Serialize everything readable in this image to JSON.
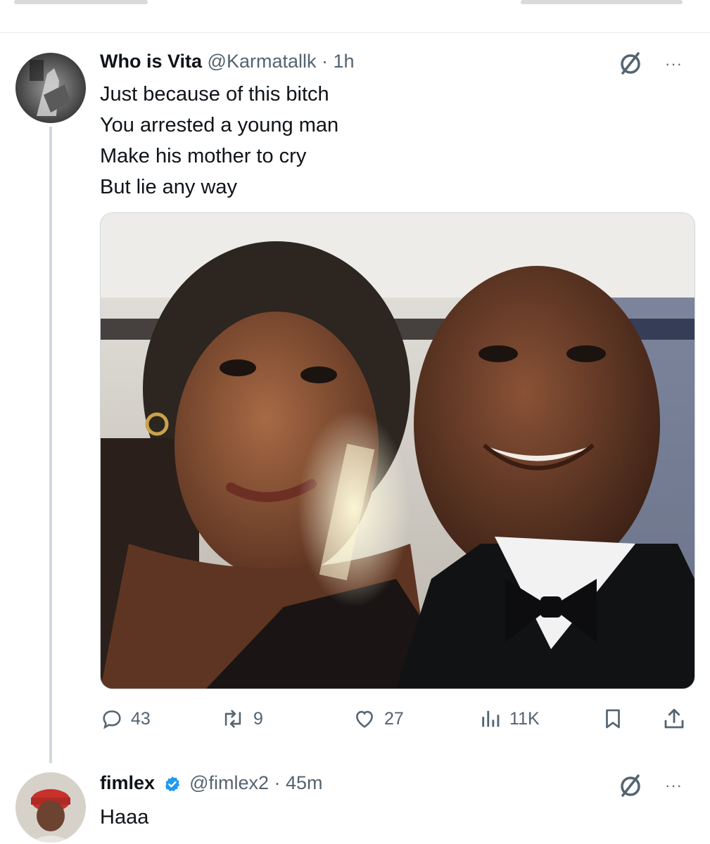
{
  "tweet1": {
    "name": "Who is Vita",
    "handle": "@Karmatallk",
    "separator": " · ",
    "time": "1h",
    "lines": [
      "Just because of this bitch",
      "You arrested a young man",
      "Make his mother to cry",
      "But lie any way"
    ],
    "more_label": "···",
    "stats": {
      "replies": "43",
      "reposts": "9",
      "likes": "27",
      "views": "11K"
    }
  },
  "tweet2": {
    "name": "fimlex",
    "handle": "@fimlex2",
    "separator": " · ",
    "time": "45m",
    "text": "Haaa",
    "more_label": "···"
  },
  "colors": {
    "text_primary": "#0f1419",
    "text_secondary": "#536471",
    "verified_blue": "#1d9bf0",
    "thread_line": "#cfd9de"
  },
  "icons": [
    "grok-icon",
    "more-icon",
    "reply-icon",
    "repost-icon",
    "like-icon",
    "views-icon",
    "bookmark-icon",
    "share-icon",
    "verified-icon"
  ]
}
